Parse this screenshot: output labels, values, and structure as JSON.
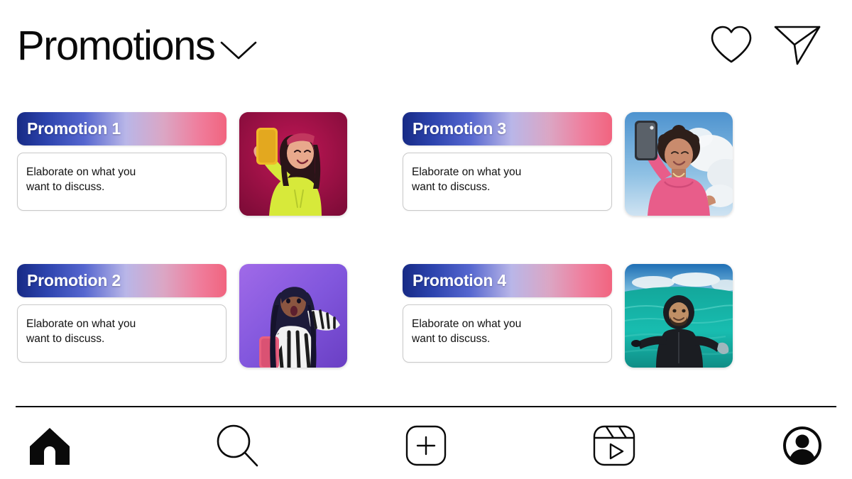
{
  "header": {
    "title": "Promotions",
    "dropdown_icon": "chevron-down-icon",
    "actions": [
      {
        "name": "heart-icon",
        "label": "Likes"
      },
      {
        "name": "send-icon",
        "label": "Direct messages"
      }
    ]
  },
  "theme": {
    "background": "#ffffff",
    "text": "#111111",
    "banner_gradient_start": "#172a85",
    "banner_gradient_mid": "#b9b6e8",
    "banner_gradient_end": "#f1647f",
    "banner_text": "#ffffff",
    "card_border": "#c9c9c9",
    "divider": "#0c0c0c"
  },
  "promotions": [
    {
      "title": "Promotion 1",
      "body": "Elaborate on what you\nwant to discuss.",
      "image": {
        "name": "promo-image-1",
        "alt": "Woman in neon yellow top taking a selfie with a yellow phone on a magenta background",
        "background": "#9c0f45",
        "accent": "#d7e93a",
        "phone": "#f0b928"
      }
    },
    {
      "title": "Promotion 2",
      "body": "Elaborate on what you\nwant to discuss.",
      "image": {
        "name": "promo-image-2",
        "alt": "Woman in zebra print top holding a pink phone on a purple background",
        "background": "#8b5ae0",
        "accent": "#f0f0f0",
        "phone": "#e8607f"
      }
    },
    {
      "title": "Promotion 3",
      "body": "Elaborate on what you\nwant to discuss.",
      "image": {
        "name": "promo-image-3",
        "alt": "Person in a pink shirt taking a selfie against blue sky with clouds",
        "background": "#6fa8d6",
        "accent": "#e85d8a",
        "phone": "#2d3138"
      }
    },
    {
      "title": "Promotion 4",
      "body": "Elaborate on what you\nwant to discuss.",
      "image": {
        "name": "promo-image-4",
        "alt": "Scuba diver in a black wetsuit floating in turquoise ocean water",
        "background": "#17b3a8",
        "accent": "#1b1d22",
        "phone": "#2a7fc4"
      }
    }
  ],
  "navbar": {
    "items": [
      {
        "name": "nav-home",
        "icon": "home-icon",
        "label": "Home",
        "active": true
      },
      {
        "name": "nav-search",
        "icon": "search-icon",
        "label": "Search",
        "active": false
      },
      {
        "name": "nav-create",
        "icon": "plus-square-icon",
        "label": "Create",
        "active": false
      },
      {
        "name": "nav-reels",
        "icon": "reels-icon",
        "label": "Reels",
        "active": false
      },
      {
        "name": "nav-profile",
        "icon": "profile-avatar-icon",
        "label": "Profile",
        "active": false
      }
    ]
  }
}
